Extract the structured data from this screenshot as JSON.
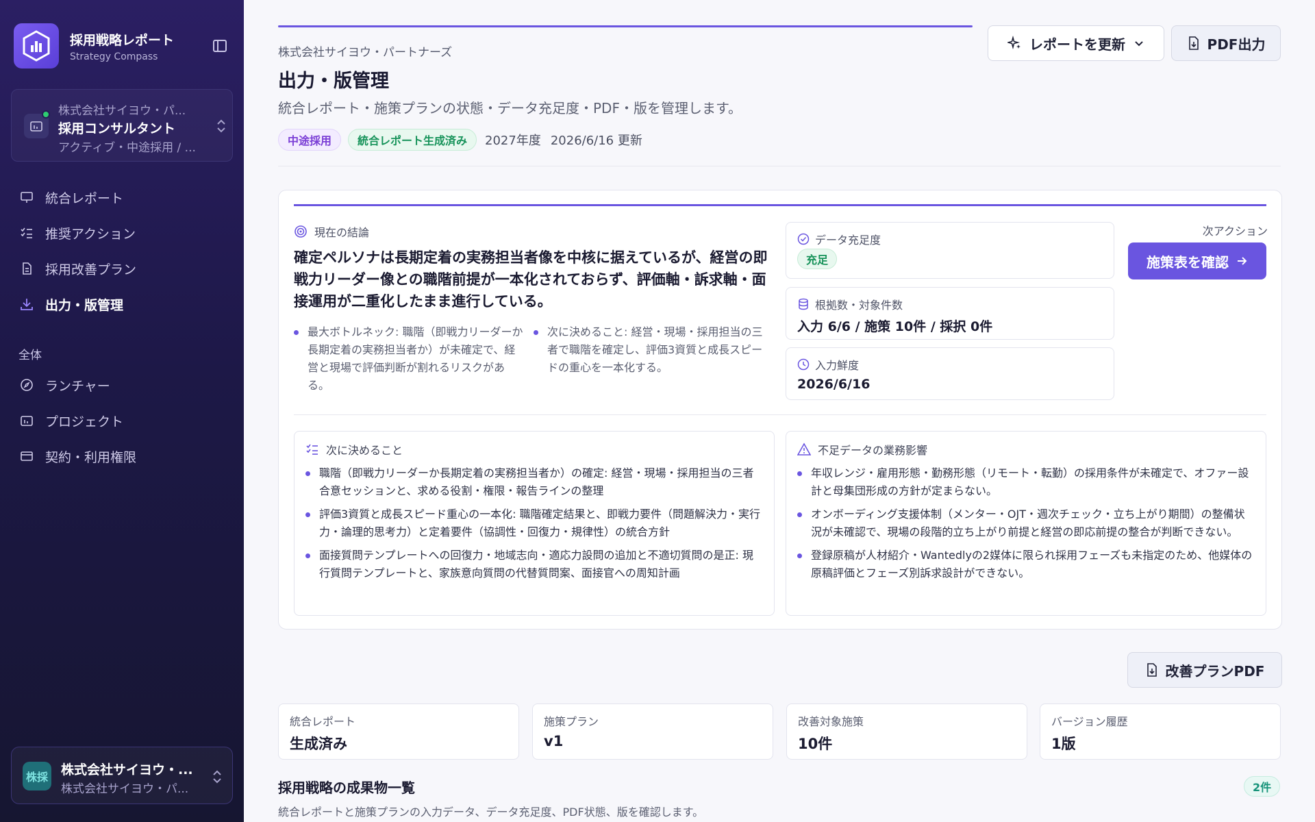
{
  "brand": {
    "title": "採用戦略レポート",
    "subtitle": "Strategy Compass"
  },
  "context": {
    "line1": "株式会社サイヨウ・パ...",
    "line2": "採用コンサルタント",
    "line3": "アクティブ・中途採用 / ..."
  },
  "nav": {
    "items": [
      {
        "label": "統合レポート",
        "icon": "monitor-icon"
      },
      {
        "label": "推奨アクション",
        "icon": "checklist-icon"
      },
      {
        "label": "採用改善プラン",
        "icon": "document-icon"
      },
      {
        "label": "出力・版管理",
        "icon": "download-icon",
        "active": true
      }
    ],
    "section_label": "全体",
    "global_items": [
      {
        "label": "ランチャー",
        "icon": "compass-icon"
      },
      {
        "label": "プロジェクト",
        "icon": "project-icon"
      },
      {
        "label": "契約・利用権限",
        "icon": "card-icon"
      }
    ]
  },
  "account": {
    "avatar": "株採",
    "name": "株式会社サイヨウ・...",
    "sub": "株式会社サイヨウ・パ..."
  },
  "header": {
    "company": "株式会社サイヨウ・パートナーズ",
    "title": "出力・版管理",
    "description": "統合レポート・施策プランの状態・データ充足度・PDF・版を管理します。",
    "tags": [
      "中途採用",
      "統合レポート生成済み"
    ],
    "fiscal_year": "2027年度",
    "updated": "2026/6/16 更新",
    "refresh_label": "レポートを更新",
    "pdf_label": "PDF出力"
  },
  "summary": {
    "conclusion_label": "現在の結論",
    "conclusion": "確定ペルソナは長期定着の実務担当者像を中核に据えているが、経営の即戦力リーダー像との職階前提が一本化されておらず、評価軸・訴求軸・面接運用が二重化したまま進行している。",
    "bottleneck": "最大ボトルネック: 職階（即戦力リーダーか長期定着の実務担当者か）が未確定で、経営と現場で評価判断が割れるリスクがある。",
    "next_decision": "次に決めること: 経営・現場・採用担当の三者で職階を確定し、評価3資質と成長スピードの重心を一本化する。",
    "data_label": "データ充足度",
    "data_status": "充足",
    "basis_label": "根拠数・対象件数",
    "basis_value": "入力 6/6 / 施策 10件 / 採択 0件",
    "fresh_label": "入力鮮度",
    "fresh_value": "2026/6/16",
    "next_action_label": "次アクション",
    "next_action_button": "施策表を確認"
  },
  "decisions": {
    "title": "次に決めること",
    "items": [
      "職階（即戦力リーダーか長期定着の実務担当者か）の確定: 経営・現場・採用担当の三者合意セッションと、求める役割・権限・報告ラインの整理",
      "評価3資質と成長スピード重心の一本化: 職階確定結果と、即戦力要件（問題解決力・実行力・論理的思考力）と定着要件（協調性・回復力・規律性）の統合方針",
      "面接質問テンプレートへの回復力・地域志向・適応力設問の追加と不適切質問の是正: 現行質問テンプレートと、家族意向質問の代替質問案、面接官への周知計画"
    ]
  },
  "impacts": {
    "title": "不足データの業務影響",
    "items": [
      "年収レンジ・雇用形態・勤務形態（リモート・転勤）の採用条件が未確定で、オファー設計と母集団形成の方針が定まらない。",
      "オンボーディング支援体制（メンター・OJT・週次チェック・立ち上がり期間）の整備状況が未確認で、現場の段階的立ち上がり前提と経営の即応前提の整合が判断できない。",
      "登録原稿が人材紹介・Wantedlyの2媒体に限られ採用フェーズも未指定のため、他媒体の原稿評価とフェーズ別訴求設計ができない。"
    ]
  },
  "plan_pdf_label": "改善プランPDF",
  "stats": [
    {
      "label": "統合レポート",
      "value": "生成済み"
    },
    {
      "label": "施策プラン",
      "value": "v1"
    },
    {
      "label": "改善対象施策",
      "value": "10件"
    },
    {
      "label": "バージョン履歴",
      "value": "1版"
    }
  ],
  "deliverables": {
    "title": "採用戦略の成果物一覧",
    "description": "統合レポートと施策プランの入力データ、データ充足度、PDF状態、版を確認します。",
    "count": "2件"
  }
}
